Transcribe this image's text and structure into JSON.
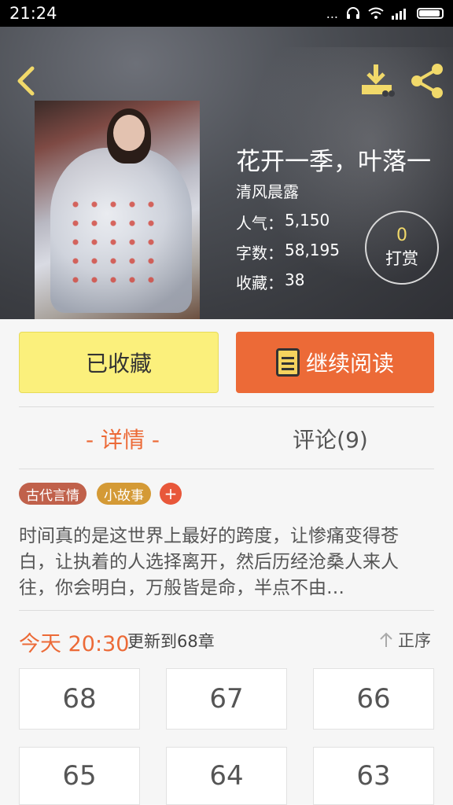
{
  "status_bar": {
    "time": "21:24",
    "dots": "..."
  },
  "book": {
    "title": "花开一季，叶落一",
    "author": "清风晨露",
    "popularity_label": "人气：",
    "popularity_value": "5,150",
    "words_label": "字数：",
    "words_value": "58,195",
    "favorites_label": "收藏：",
    "favorites_value": "38"
  },
  "reward": {
    "count": "0",
    "label": "打赏"
  },
  "actions": {
    "collected_label": "已收藏",
    "continue_label": "继续阅读"
  },
  "tabs": {
    "detail": "- 详情 -",
    "comments": "评论(9)"
  },
  "tags": [
    {
      "label": "古代言情",
      "color": "#c0614b"
    },
    {
      "label": "小故事",
      "color": "#d49a36"
    }
  ],
  "tag_add": "+",
  "synopsis": "时间真的是这世界上最好的跨度，让惨痛变得苍白，让执着的人选择离开，然后历经沧桑人来人往，你会明白，万般皆是命，半点不由…",
  "update": {
    "time": "今天 20:30",
    "text": "更新到68章",
    "sort_label": "正序"
  },
  "chapters": [
    "68",
    "67",
    "66",
    "65",
    "64",
    "63"
  ],
  "colors": {
    "accent": "#ec6a37",
    "collected_bg": "#fbf07c",
    "icon_yellow": "#f1d96a"
  }
}
